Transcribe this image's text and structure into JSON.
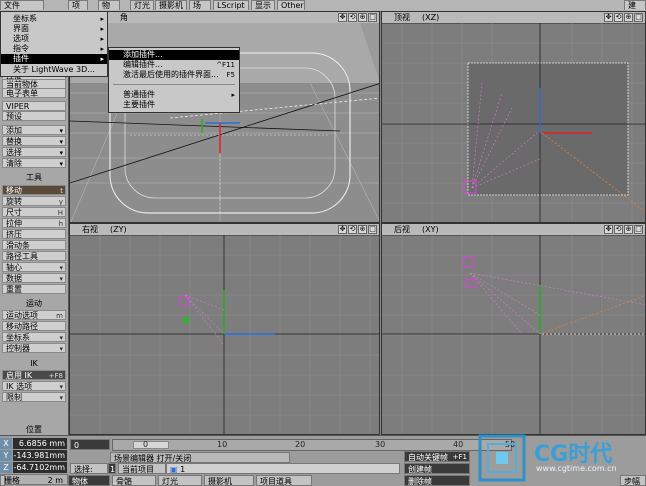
{
  "tabs": [
    "项目",
    "物体",
    "灯光",
    "摄影机",
    "场景",
    "LScript",
    "显示",
    "Other"
  ],
  "topleft": "文件",
  "topright": "建模",
  "main_menu": {
    "items": [
      {
        "label": "坐标系",
        "chev": "▸"
      },
      {
        "label": "界面",
        "chev": "▸"
      },
      {
        "label": "选项",
        "chev": "▸"
      },
      {
        "label": "指令",
        "chev": "▸"
      },
      {
        "label": "插件",
        "chev": "▸"
      },
      {
        "label": "关于 LightWave 3D...",
        "chev": ""
      }
    ]
  },
  "sub_menu": {
    "items": [
      {
        "label": "添加插件...",
        "key": ""
      },
      {
        "label": "编辑插件...",
        "key": "^F11"
      },
      {
        "label": "激活最后使用的插件界面...",
        "key": "F5"
      },
      {
        "label": "普通插件",
        "key": "▸"
      },
      {
        "label": "主要插件",
        "key": ""
      }
    ]
  },
  "left_panel": {
    "partial_top": "插件",
    "buttons_a": [
      {
        "label": "当前物体",
        "arrow": false
      },
      {
        "label": "电子表单",
        "arrow": false
      }
    ],
    "viper": "VIPER",
    "preset": "预设",
    "buttons_b": [
      {
        "label": "添加",
        "arrow": true
      },
      {
        "label": "替换",
        "arrow": true
      },
      {
        "label": "选择",
        "arrow": true
      },
      {
        "label": "清除",
        "arrow": true
      }
    ],
    "tools_head": "工具",
    "tools": [
      {
        "label": "移动",
        "key": "t",
        "style": "active"
      },
      {
        "label": "旋转",
        "key": "y",
        "style": ""
      },
      {
        "label": "尺寸",
        "key": "H",
        "style": ""
      },
      {
        "label": "拉伸",
        "key": "h",
        "style": ""
      },
      {
        "label": "挤压",
        "key": "",
        "style": ""
      },
      {
        "label": "滑动条",
        "key": "",
        "style": ""
      },
      {
        "label": "路径工具",
        "key": "",
        "style": ""
      },
      {
        "label": "轴心",
        "key": "▾",
        "style": ""
      },
      {
        "label": "数据",
        "key": "▾",
        "style": ""
      },
      {
        "label": "重置",
        "key": "",
        "style": ""
      }
    ],
    "motion_head": "运动",
    "motion": [
      {
        "label": "运动选项",
        "key": "m",
        "style": ""
      },
      {
        "label": "移动路径",
        "key": "",
        "style": ""
      },
      {
        "label": "坐标系",
        "key": "▾",
        "style": ""
      },
      {
        "label": "控制器",
        "key": "▾",
        "style": ""
      }
    ],
    "ik_head": "IK",
    "ik": [
      {
        "label": "启用 IK",
        "key": "+F8",
        "style": "dark"
      },
      {
        "label": "IK 选项",
        "key": "▾",
        "style": ""
      },
      {
        "label": "限制",
        "key": "▾",
        "style": ""
      }
    ]
  },
  "viewports": {
    "topleft": {
      "title": "",
      "axis": "角"
    },
    "topright": {
      "title": "顶视",
      "axis": "(XZ)"
    },
    "bottomleft": {
      "title": "右视",
      "axis": "(ZY)"
    },
    "bottomright": {
      "title": "后视",
      "axis": "(XY)"
    }
  },
  "bottom": {
    "position_label": "位置",
    "x_label": "X",
    "x_val": "6.6856 mm",
    "y_label": "Y",
    "y_val": "-143.981mm",
    "z_label": "Z",
    "z_val": "-64.7102mm",
    "grid_label": "栅格",
    "grid_val": "2 m",
    "frame_start": "0",
    "ticks": [
      "0",
      "10",
      "20",
      "30",
      "40",
      "50"
    ],
    "select_label": "选择:",
    "select_val": "1",
    "current_label": "当前项目",
    "current_val": "1",
    "row_buttons": [
      "物体",
      "骨骼",
      "灯光",
      "摄影机",
      "项目道具"
    ],
    "scene_editor": "场景编辑器 打开/关闭",
    "autokey": "自动关键帧",
    "autokey_key": "+F1",
    "create_key": "创建帧",
    "delete_key": "删除帧",
    "step": "步幅"
  },
  "watermark": {
    "brand": "CG时代",
    "url": "www.cgtime.com.cn"
  }
}
